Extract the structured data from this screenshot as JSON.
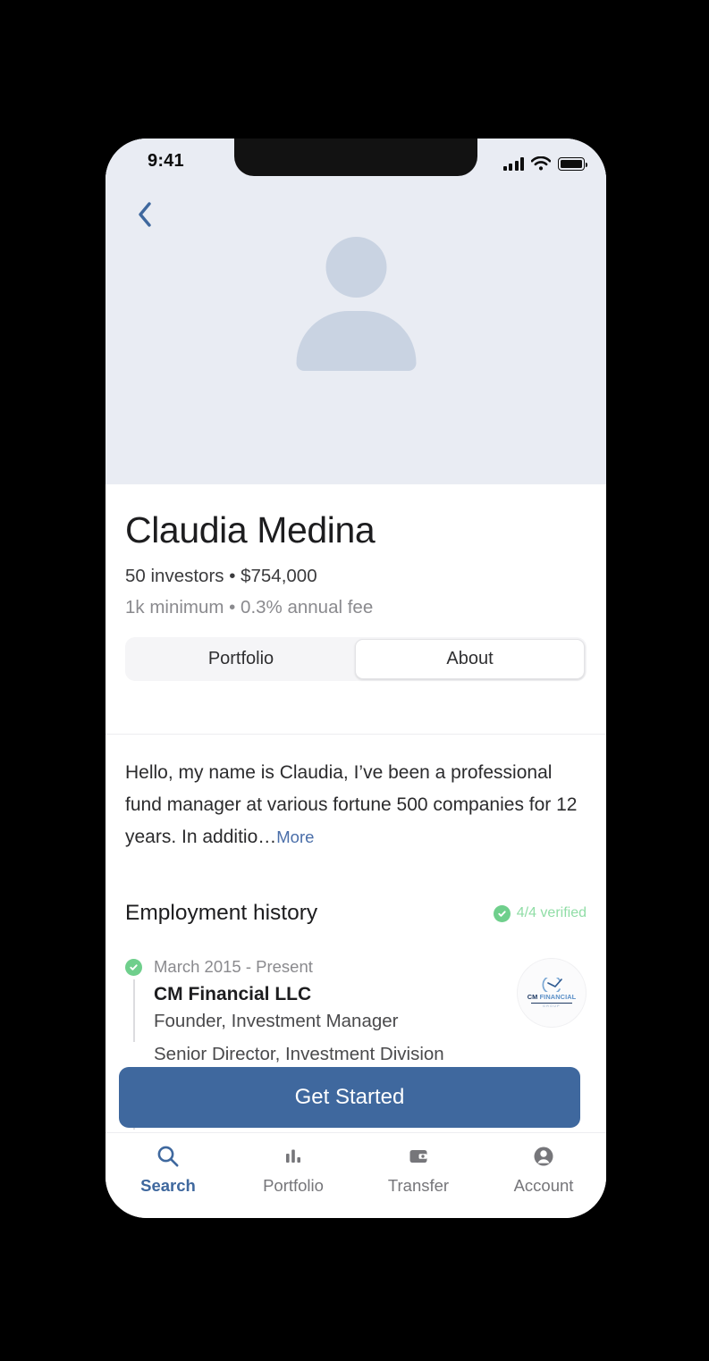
{
  "status_bar": {
    "time": "9:41",
    "signal_icon": "cellular-signal-icon",
    "wifi_icon": "wifi-icon",
    "battery_icon": "battery-icon"
  },
  "nav": {
    "back_icon": "chevron-left-icon"
  },
  "profile": {
    "avatar_icon": "person-placeholder-avatar",
    "name": "Claudia Medina",
    "stats_primary": "50 investors • $754,000",
    "stats_secondary": "1k minimum • 0.3% annual fee"
  },
  "tabs": {
    "items": [
      {
        "label": "Portfolio",
        "active": false
      },
      {
        "label": "About",
        "active": true
      }
    ]
  },
  "bio": {
    "text": "Hello, my name is Claudia, I’ve been a professional fund manager at various fortune 500 companies for 12 years.  In additio…",
    "more_label": "More"
  },
  "employment": {
    "section_title": "Employment history",
    "verified_label": "4/4 verified",
    "verified_icon": "check-circle-icon",
    "verified_color": "#6fcf8c",
    "entries": [
      {
        "date": "March 2015 - Present",
        "company": "CM Financial LLC",
        "role": "Founder, Investment Manager",
        "logo_name": "CM",
        "logo_name_2": "FINANCIAL",
        "logo_sub": "GROUP"
      },
      {
        "date": "",
        "company": "",
        "role": "Senior Director, Investment Division",
        "logo_name": "",
        "logo_name_2": "",
        "logo_sub": ""
      }
    ]
  },
  "cta": {
    "label": "Get Started",
    "color": "#3f689e"
  },
  "bottom_nav": {
    "items": [
      {
        "label": "Search",
        "icon": "search-icon",
        "active": true
      },
      {
        "label": "Portfolio",
        "icon": "bar-chart-icon",
        "active": false
      },
      {
        "label": "Transfer",
        "icon": "wallet-icon",
        "active": false
      },
      {
        "label": "Account",
        "icon": "person-circle-icon",
        "active": false
      }
    ]
  }
}
